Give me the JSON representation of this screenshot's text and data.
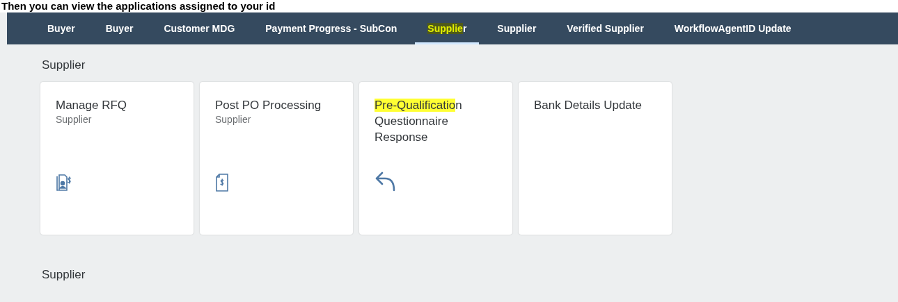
{
  "caption": "Then you can view the applications assigned to your id",
  "tabs": [
    {
      "parts": [
        {
          "text": "Buyer",
          "highlighted": false
        }
      ],
      "selected": false
    },
    {
      "parts": [
        {
          "text": "Buyer",
          "highlighted": false
        }
      ],
      "selected": false
    },
    {
      "parts": [
        {
          "text": "Customer MDG",
          "highlighted": false
        }
      ],
      "selected": false
    },
    {
      "parts": [
        {
          "text": "Payment Progress - SubCon",
          "highlighted": false
        }
      ],
      "selected": false
    },
    {
      "parts": [
        {
          "text": "Supplie",
          "highlighted": true
        },
        {
          "text": "r",
          "highlighted": false
        }
      ],
      "selected": true
    },
    {
      "parts": [
        {
          "text": "Supplier",
          "highlighted": false
        }
      ],
      "selected": false
    },
    {
      "parts": [
        {
          "text": "Verified Supplier",
          "highlighted": false
        }
      ],
      "selected": false
    },
    {
      "parts": [
        {
          "text": "WorkflowAgentID Update",
          "highlighted": false
        }
      ],
      "selected": false
    }
  ],
  "sections": [
    {
      "title": "Supplier",
      "tiles": [
        {
          "title_parts": [
            {
              "text": "Manage RFQ",
              "highlighted": false
            }
          ],
          "subtitle": "Supplier",
          "kind": "rfq"
        },
        {
          "title_parts": [
            {
              "text": "Post PO Processing",
              "highlighted": false
            }
          ],
          "subtitle": "Supplier",
          "kind": "invoice"
        },
        {
          "title_parts": [
            {
              "text": "Pre-Qualificatio",
              "highlighted": true
            },
            {
              "text": "n Questionnaire Response",
              "highlighted": false
            }
          ],
          "kind": "reply"
        },
        {
          "title_parts": [
            {
              "text": "Bank Details Update",
              "highlighted": false
            }
          ]
        }
      ]
    },
    {
      "title": "Supplier"
    }
  ]
}
